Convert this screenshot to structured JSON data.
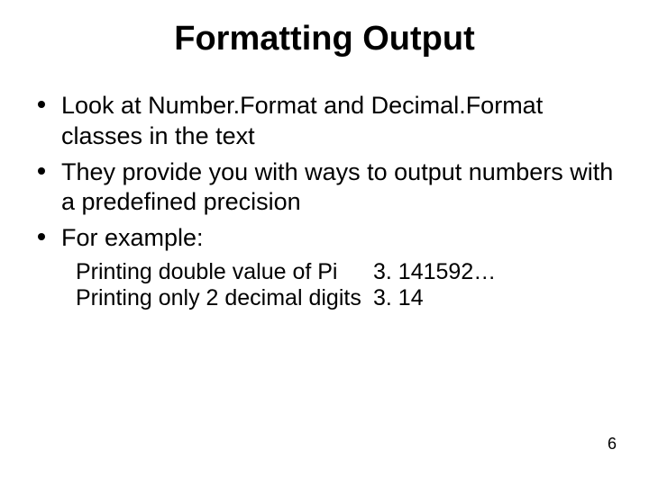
{
  "title": "Formatting Output",
  "bullets": [
    "Look at Number.Format and Decimal.Format classes in the text",
    "They provide you with ways to output numbers with a predefined precision",
    "For example:"
  ],
  "examples": [
    {
      "label": "Printing double value of Pi",
      "value": "3. 141592…"
    },
    {
      "label": "Printing only 2 decimal digits",
      "value": "3. 14"
    }
  ],
  "pageNumber": "6"
}
